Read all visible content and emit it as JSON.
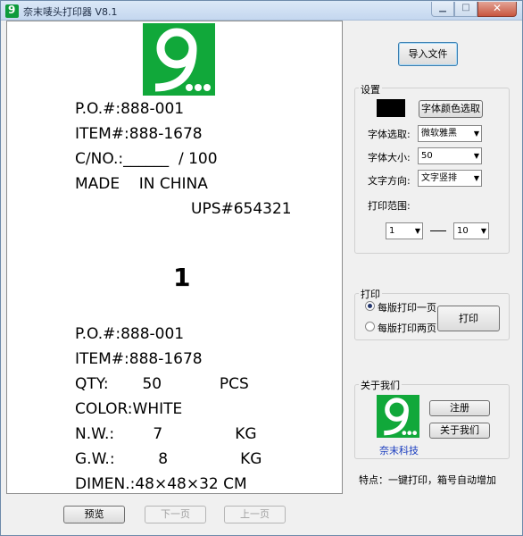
{
  "window": {
    "title": "奈末唛头打印器 V8.1",
    "icon_glyph": "9"
  },
  "preview": {
    "logo_glyph": "9...",
    "lines": [
      "P.O.#:888-001",
      "ITEM#:888-1678",
      "C/NO.:______  / 100",
      "MADE    IN CHINA",
      "UPS#654321",
      "1",
      "P.O.#:888-001",
      "ITEM#:888-1678",
      "QTY:       50            PCS",
      "COLOR:WHITE",
      "N.W.:        7               KG",
      "G.W.:         8               KG",
      "DIMEN.:48×48×32 CM"
    ]
  },
  "footer_buttons": {
    "preview": "预览",
    "next": "下一页",
    "prev": "上一页"
  },
  "import_button": "导入文件",
  "settings": {
    "title": "设置",
    "color_button": "字体颜色选取",
    "font_label": "字体选取:",
    "font_value": "微软雅黑",
    "size_label": "字体大小:",
    "size_value": "50",
    "direction_label": "文字方向:",
    "direction_value": "文字竖排",
    "range_label": "打印范围:",
    "range_from": "1",
    "range_to": "10",
    "swatch_color": "#000000"
  },
  "print": {
    "title": "打印",
    "option1": "每版打印一页",
    "option2": "每版打印两页",
    "button": "打印"
  },
  "about": {
    "title": "关于我们",
    "company": "奈末科技",
    "register_button": "注册",
    "about_button": "关于我们",
    "logo_glyph": "9..."
  },
  "feature_text": "特点：一键打印，箱号自动增加",
  "colors": {
    "brand_green": "#11a83a",
    "company_text": "#1a3dbf"
  }
}
